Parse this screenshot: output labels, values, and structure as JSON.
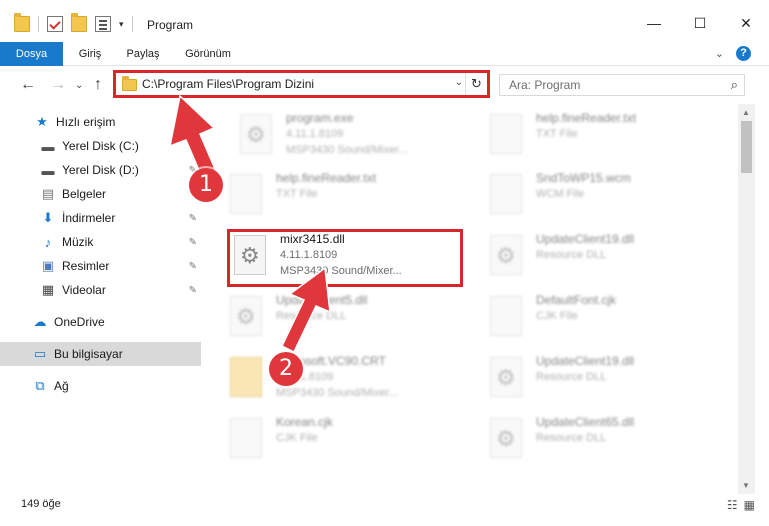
{
  "window": {
    "title": "Program",
    "minimize": "—",
    "maximize": "☐",
    "close": "✕"
  },
  "ribbon": {
    "tabs": [
      "Dosya",
      "Giriş",
      "Paylaş",
      "Görünüm"
    ],
    "collapse": "⌄",
    "help": "?"
  },
  "address": {
    "path": "C:\\Program Files\\Program Dizini",
    "search_placeholder": "Ara: Program"
  },
  "sidebar": {
    "items": [
      {
        "label": "Hızlı erişim",
        "icon": "star-icon",
        "color": "#1979ca"
      },
      {
        "label": "Yerel Disk (C:)",
        "icon": "drive-icon"
      },
      {
        "label": "Yerel Disk (D:)",
        "icon": "drive-icon"
      },
      {
        "label": "Belgeler",
        "icon": "documents-icon"
      },
      {
        "label": "İndirmeler",
        "icon": "download-icon",
        "color": "#1979ca"
      },
      {
        "label": "Müzik",
        "icon": "music-icon",
        "color": "#1979ca"
      },
      {
        "label": "Resimler",
        "icon": "pictures-icon"
      },
      {
        "label": "Videolar",
        "icon": "video-icon"
      },
      {
        "label": "OneDrive",
        "icon": "cloud-icon",
        "color": "#1979ca"
      },
      {
        "label": "Bu bilgisayar",
        "icon": "computer-icon"
      },
      {
        "label": "Ağ",
        "icon": "network-icon"
      }
    ]
  },
  "files": [
    {
      "name": "program.exe",
      "l1": "4.11.1.8109",
      "l2": "MSP3430 Sound/Mixer...",
      "blur": true
    },
    {
      "name": "help.fineReader.txt",
      "l1": "TXT File",
      "l2": "",
      "blur": true
    },
    {
      "name": "help.fineReader.txt",
      "l1": "TXT File",
      "l2": "",
      "blur": true
    },
    {
      "name": "SndToWP15.wcm",
      "l1": "WCM File",
      "l2": "",
      "blur": true
    },
    {
      "name": "mixr3415.dll",
      "l1": "4.11.1.8109",
      "l2": "MSP3430 Sound/Mixer...",
      "blur": false
    },
    {
      "name": "UpdateClient19.dll",
      "l1": "Resource DLL",
      "l2": "",
      "blur": true
    },
    {
      "name": "UpdateClient5.dll",
      "l1": "Resource DLL",
      "l2": "",
      "blur": true
    },
    {
      "name": "DefaultFont.cjk",
      "l1": "CJK File",
      "l2": "",
      "blur": true
    },
    {
      "name": "Microsoft.VC90.CRT",
      "l1": "4.11.1.8109",
      "l2": "MSP3430 Sound/Mixer...",
      "blur": true
    },
    {
      "name": "UpdateClient19.dll",
      "l1": "Resource DLL",
      "l2": "",
      "blur": true
    },
    {
      "name": "Korean.cjk",
      "l1": "CJK File",
      "l2": "",
      "blur": true
    },
    {
      "name": "UpdateClient65.dll",
      "l1": "Resource DLL",
      "l2": "",
      "blur": true
    }
  ],
  "status": {
    "count": "149 öğe"
  },
  "annotations": [
    "1",
    "2"
  ],
  "colors": {
    "accent": "#1979ca",
    "highlight": "#d9262b",
    "badge": "#e0373c"
  }
}
